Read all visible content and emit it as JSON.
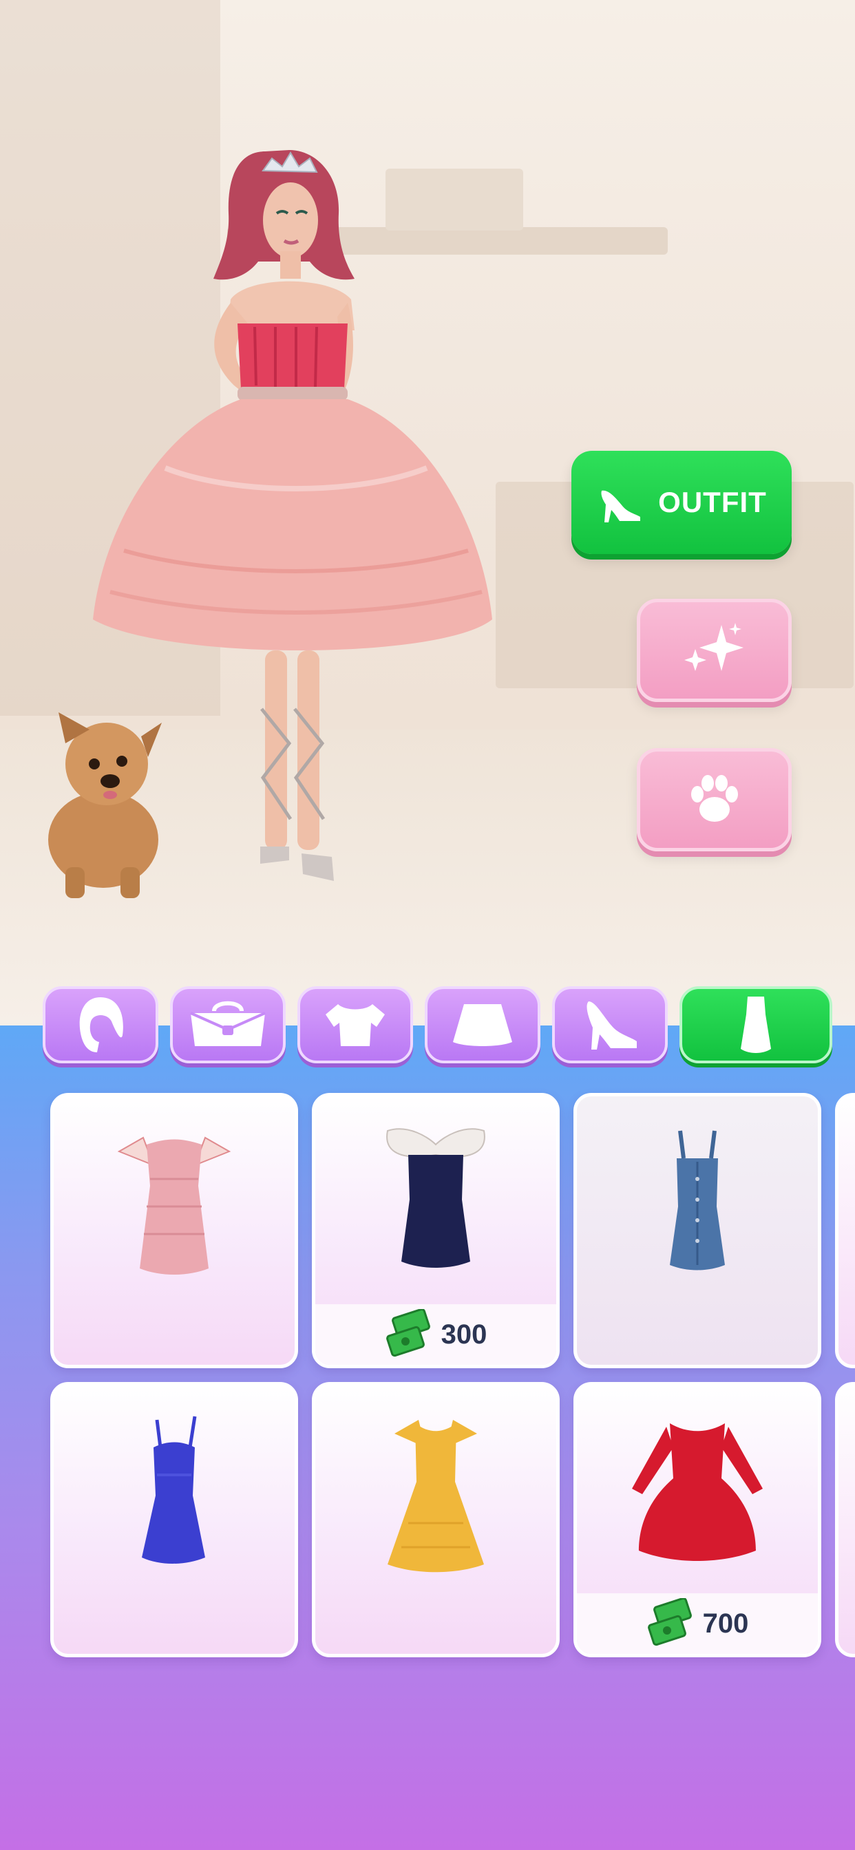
{
  "side_buttons": {
    "outfit_label": "OUTFIT"
  },
  "categories": {
    "tabs": [
      {
        "icon": "hair-icon",
        "active": false
      },
      {
        "icon": "bag-icon",
        "active": false
      },
      {
        "icon": "top-icon",
        "active": false
      },
      {
        "icon": "skirt-icon",
        "active": false
      },
      {
        "icon": "heel-icon",
        "active": false
      },
      {
        "icon": "dress-icon",
        "active": true
      }
    ]
  },
  "items": [
    {
      "name": "pink-ruffle-dress",
      "color": "#e9a3ad",
      "price": null
    },
    {
      "name": "navy-bow-dress",
      "color": "#1d2150",
      "price": "300"
    },
    {
      "name": "denim-dress",
      "color": "#4b74a8",
      "price": null
    },
    {
      "name": "blue-sequin-dress",
      "color": "#3b3fd0",
      "price": null
    },
    {
      "name": "yellow-dotted-dress",
      "color": "#f0b73a",
      "price": null
    },
    {
      "name": "red-long-sleeve-dress",
      "color": "#d61a2e",
      "price": "700"
    }
  ],
  "colors": {
    "accent_green": "#1ccf48",
    "pink_button": "#f5a9c9",
    "tab_purple": "#c68af7"
  }
}
